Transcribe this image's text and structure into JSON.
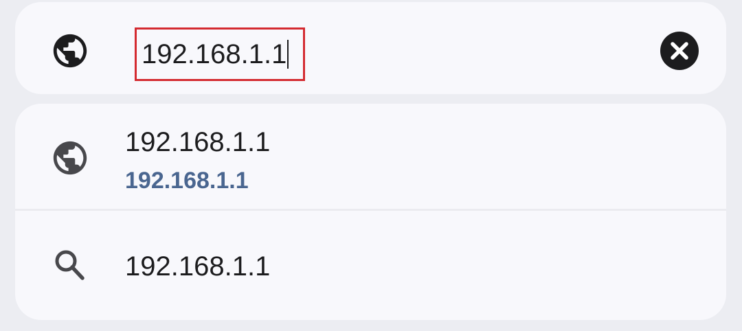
{
  "address_bar": {
    "value": "192.168.1.1",
    "site_icon": "globe-icon",
    "clear_icon": "clear-icon"
  },
  "suggestions": [
    {
      "icon": "globe-icon",
      "title": "192.168.1.1",
      "subtitle": "192.168.1.1"
    },
    {
      "icon": "search-icon",
      "title": "192.168.1.1"
    }
  ],
  "colors": {
    "background": "#ecedf2",
    "card": "#f8f8fc",
    "text": "#1c1c1e",
    "url_accent": "#4a6690",
    "highlight_border": "#d42a30",
    "icon": "#1c1c1e",
    "icon_muted": "#48484c"
  }
}
